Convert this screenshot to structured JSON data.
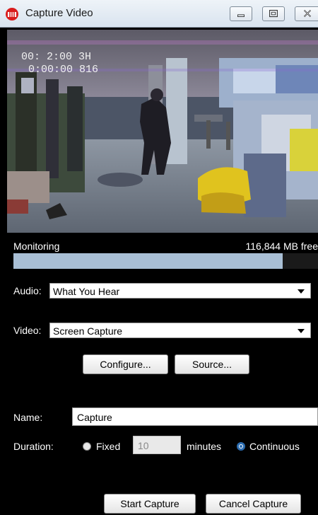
{
  "window": {
    "title": "Capture Video"
  },
  "titlebar": {
    "icons": [
      "app-icon",
      "minimize-icon",
      "maximize-icon",
      "close-icon"
    ]
  },
  "status": {
    "label": "Monitoring",
    "free_space": "116,844 MB free",
    "progress_fraction": 0.885
  },
  "audio": {
    "label": "Audio:",
    "value": "What You Hear"
  },
  "video": {
    "label": "Video:",
    "value": "Screen Capture"
  },
  "buttons": {
    "configure": "Configure...",
    "source": "Source...",
    "start_capture": "Start Capture",
    "cancel_capture": "Cancel Capture"
  },
  "name": {
    "label": "Name:",
    "value": "Capture"
  },
  "duration": {
    "label": "Duration:",
    "fixed_label": "Fixed",
    "minutes_value": "10",
    "minutes_label": "minutes",
    "continuous_label": "Continuous",
    "selected": "continuous"
  },
  "preview_overlay": {
    "line1": "00: 2:00   3H",
    "line2": "0:00:00   816"
  }
}
